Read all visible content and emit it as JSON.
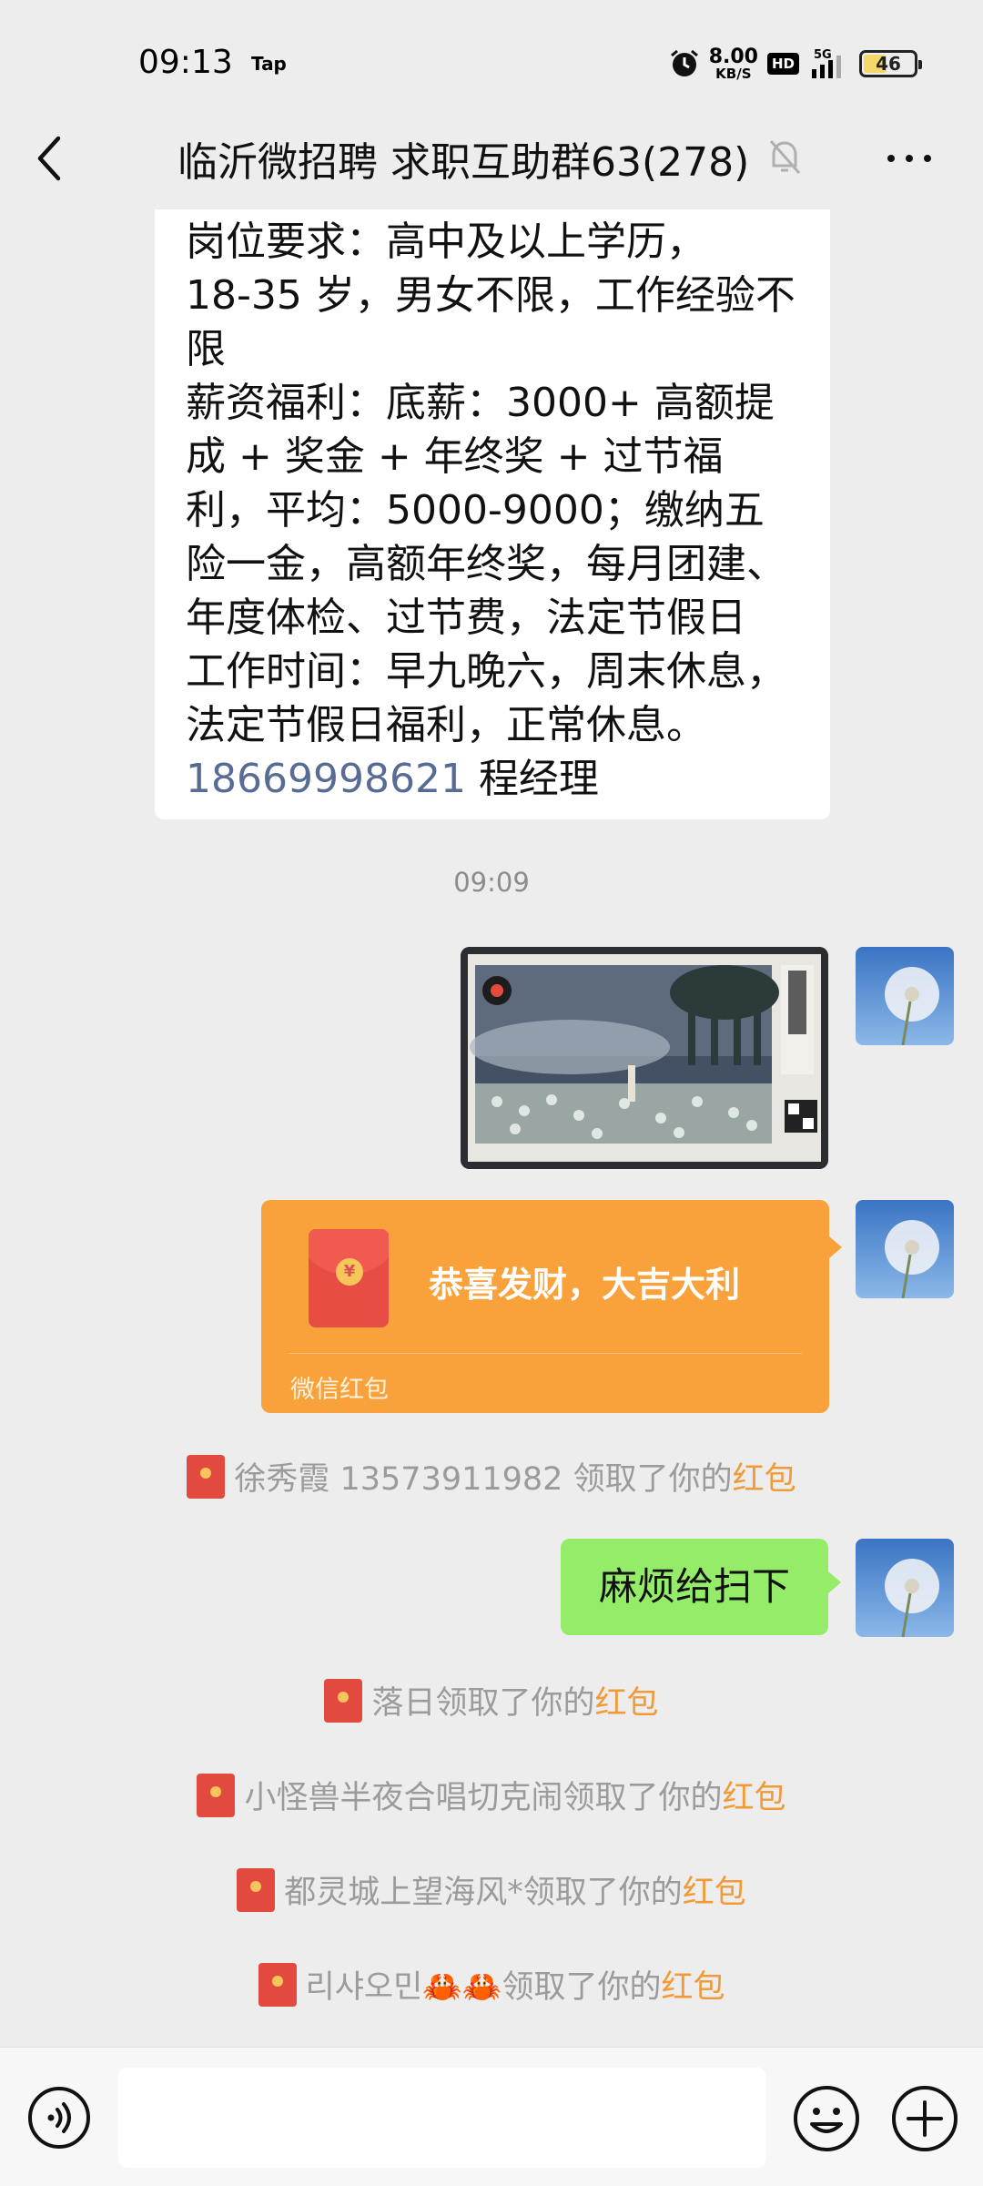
{
  "status_bar": {
    "time": "09:13",
    "app_badge": "Tap",
    "net_speed_value": "8.00",
    "net_speed_unit": "KB/S",
    "hd_label": "HD",
    "signal_label": "5G",
    "battery_level": "46",
    "battery_fraction": 0.46
  },
  "header": {
    "title": "临沂微招聘 求职互助群63(278)",
    "back_icon": "chevron-left-icon",
    "mute_icon": "bell-mute-icon",
    "more_icon": "more-dots-icon"
  },
  "job_post": {
    "lines": [
      "岗位要求：高中及以上学历，",
      "18-35 岁，男女不限，工作经验不限",
      "薪资福利：底薪：3000+ 高额提成 + 奖金 + 年终奖 + 过节福利，平均：5000-9000；缴纳五险一金，高额年终奖，每月团建、年度体检、过节费，法定节假日",
      "工作时间：早九晚六，周末休息，法定节假日福利，正常休息。"
    ],
    "phone": "18669998621",
    "contact": "程经理"
  },
  "timestamp": "09:09",
  "red_packet": {
    "greeting": "恭喜发财，大吉大利",
    "footer": "微信红包",
    "coin_symbol": "¥"
  },
  "claims": [
    {
      "who": "徐秀霞 13573911982",
      "action": "领取了你的",
      "item": "红包"
    },
    {
      "who": "落日",
      "action": "领取了你的",
      "item": "红包"
    },
    {
      "who": "小怪兽半夜合唱切克闹",
      "action": "领取了你的",
      "item": "红包"
    },
    {
      "who": "都灵城上望海风*",
      "action": "领取了你的",
      "item": "红包"
    },
    {
      "who": "리샤오민🦀🦀",
      "action": "领取了你的",
      "item": "红包"
    }
  ],
  "text_message": "麻烦给扫下",
  "bottom_bar": {
    "voice_icon": "voice-icon",
    "emoji_icon": "emoji-icon",
    "plus_icon": "plus-icon"
  },
  "colors": {
    "chat_bg": "#ededed",
    "green_bubble": "#95ec69",
    "red_packet": "#f9a13a",
    "highlight": "#f19a38",
    "phone_link": "#576b95"
  }
}
